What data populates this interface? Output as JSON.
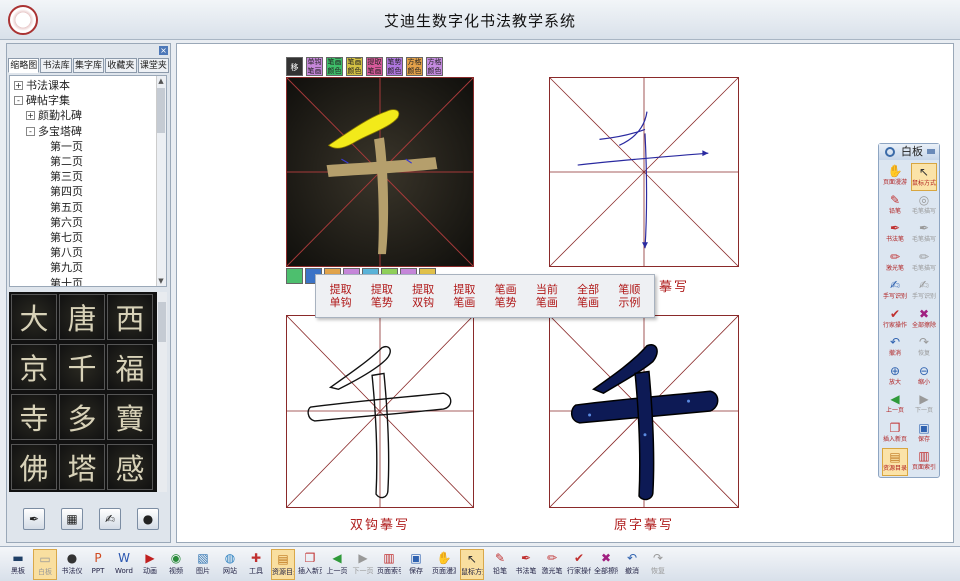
{
  "app": {
    "title": "艾迪生数字化书法教学系统"
  },
  "left_panel": {
    "close_glyph": "×",
    "tabs": [
      "缩略图",
      "书法库",
      "集字库",
      "收藏夹",
      "课堂夹"
    ],
    "tree": [
      {
        "label": "书法课本",
        "level": 0,
        "toggle": "+"
      },
      {
        "label": "碑帖字集",
        "level": 0,
        "toggle": "-"
      },
      {
        "label": "颜勤礼碑",
        "level": 1,
        "toggle": "+"
      },
      {
        "label": "多宝塔碑",
        "level": 1,
        "toggle": "-"
      },
      {
        "label": "第一页",
        "level": 2
      },
      {
        "label": "第二页",
        "level": 2
      },
      {
        "label": "第三页",
        "level": 2
      },
      {
        "label": "第四页",
        "level": 2
      },
      {
        "label": "第五页",
        "level": 2
      },
      {
        "label": "第六页",
        "level": 2
      },
      {
        "label": "第七页",
        "level": 2
      },
      {
        "label": "第八页",
        "level": 2
      },
      {
        "label": "第九页",
        "level": 2
      },
      {
        "label": "第十页",
        "level": 2
      }
    ],
    "thumbnails": [
      "大",
      "唐",
      "西",
      "京",
      "千",
      "福",
      "寺",
      "多",
      "寶",
      "佛",
      "塔",
      "感"
    ],
    "bottom_buttons": [
      {
        "name": "brush-tool-button",
        "glyph": "✒"
      },
      {
        "name": "grid-tool-button",
        "glyph": "▦"
      },
      {
        "name": "ink-tool-button",
        "glyph": "✍"
      },
      {
        "name": "color-tool-button",
        "glyph": "●"
      }
    ]
  },
  "canvas": {
    "grids": [
      {
        "name": "practice-grid-original",
        "caption": ""
      },
      {
        "name": "practice-grid-stroke-order",
        "caption": "摹写"
      },
      {
        "name": "practice-grid-outline",
        "caption": "双钩摹写"
      },
      {
        "name": "practice-grid-filled",
        "caption": "原字摹写"
      }
    ],
    "move_label": "移动",
    "color_buttons": [
      {
        "label": "单钩笔画",
        "color": "#c586d9"
      },
      {
        "label": "笔画颜色",
        "color": "#3fbf6a"
      },
      {
        "label": "笔画颜色",
        "color": "#d4c244"
      },
      {
        "label": "提取笔画",
        "color": "#d65a9a"
      },
      {
        "label": "笔势颜色",
        "color": "#b077e0"
      },
      {
        "label": "方格颜色",
        "color": "#e4a24a"
      },
      {
        "label": "方格颜色",
        "color": "#c58be0"
      }
    ],
    "small_buttons": [
      "#4dbf6e",
      "#3b73c6",
      "#e1a34a",
      "#c586d9",
      "#5ab3d8",
      "#8fcf5a",
      "#c586d9",
      "#e0c04a"
    ],
    "character": "千",
    "popup_menu": [
      {
        "line1": "提取",
        "line2": "单钩"
      },
      {
        "line1": "提取",
        "line2": "笔势"
      },
      {
        "line1": "提取",
        "line2": "双钩"
      },
      {
        "line1": "提取",
        "line2": "笔画"
      },
      {
        "line1": "笔画",
        "line2": "笔势"
      },
      {
        "line1": "当前",
        "line2": "笔画"
      },
      {
        "line1": "全部",
        "line2": "笔画"
      },
      {
        "line1": "笔顺",
        "line2": "示例"
      }
    ]
  },
  "whiteboard": {
    "title": "白板",
    "tools": [
      {
        "label": "页面漫游",
        "glyph": "✋",
        "color": "#c07a20",
        "sel": false
      },
      {
        "label": "鼠标方式",
        "glyph": "↖",
        "color": "#333",
        "sel": true
      },
      {
        "label": "铅笔",
        "glyph": "✎",
        "color": "#c03030",
        "sel": false
      },
      {
        "label": "毛笔描写",
        "glyph": "◎",
        "color": "#999",
        "sel": false
      },
      {
        "label": "书法笔",
        "glyph": "✒",
        "color": "#c03030",
        "sel": false
      },
      {
        "label": "毛笔描写",
        "glyph": "✒",
        "color": "#999",
        "sel": false
      },
      {
        "label": "激光笔",
        "glyph": "✏",
        "color": "#c03030",
        "sel": false
      },
      {
        "label": "毛笔描写",
        "glyph": "✏",
        "color": "#999",
        "sel": false
      },
      {
        "label": "手写识别",
        "glyph": "✍",
        "color": "#2f62b0",
        "sel": false
      },
      {
        "label": "手写识别",
        "glyph": "✍",
        "color": "#999",
        "sel": false
      },
      {
        "label": "行家操作",
        "glyph": "✔",
        "color": "#c03030",
        "sel": false
      },
      {
        "label": "全部擦除",
        "glyph": "✖",
        "color": "#a02080",
        "sel": false
      },
      {
        "label": "撤消",
        "glyph": "↶",
        "color": "#2f62b0",
        "sel": false
      },
      {
        "label": "恢复",
        "glyph": "↷",
        "color": "#999",
        "sel": false
      },
      {
        "label": "放大",
        "glyph": "⊕",
        "color": "#2f62b0",
        "sel": false
      },
      {
        "label": "缩小",
        "glyph": "⊖",
        "color": "#2f62b0",
        "sel": false
      },
      {
        "label": "上一页",
        "glyph": "◀",
        "color": "#2f9a3a",
        "sel": false
      },
      {
        "label": "下一页",
        "glyph": "▶",
        "color": "#999",
        "sel": false
      },
      {
        "label": "插入新页",
        "glyph": "❐",
        "color": "#c03030",
        "sel": false
      },
      {
        "label": "保存",
        "glyph": "▣",
        "color": "#2f62b0",
        "sel": false
      },
      {
        "label": "资源目录",
        "glyph": "▤",
        "color": "#c07a20",
        "sel": true
      },
      {
        "label": "页面索引",
        "glyph": "▥",
        "color": "#c03030",
        "sel": false
      }
    ]
  },
  "bottom_toolbar": {
    "buttons": [
      {
        "label": "黑板",
        "glyph": "▬",
        "color": "#1f3f66",
        "sel": false
      },
      {
        "label": "白板",
        "glyph": "▭",
        "color": "#999",
        "sel": true
      },
      {
        "label": "书法仪",
        "glyph": "●",
        "color": "#333",
        "sel": false
      },
      {
        "label": "PPT",
        "glyph": "P",
        "color": "#d04a20",
        "sel": false
      },
      {
        "label": "Word",
        "glyph": "W",
        "color": "#2a56b0",
        "sel": false
      },
      {
        "label": "动画",
        "glyph": "▶",
        "color": "#c02020",
        "sel": false
      },
      {
        "label": "视频",
        "glyph": "◉",
        "color": "#2a8a3a",
        "sel": false
      },
      {
        "label": "图片",
        "glyph": "▧",
        "color": "#2a70b0",
        "sel": false
      },
      {
        "label": "网站",
        "glyph": "◍",
        "color": "#2a80c0",
        "sel": false
      },
      {
        "label": "工具",
        "glyph": "✚",
        "color": "#c03030",
        "sel": false
      },
      {
        "label": "资源目录",
        "glyph": "▤",
        "color": "#c07a20",
        "sel": true
      },
      {
        "label": "插入新页",
        "glyph": "❐",
        "color": "#c03030",
        "sel": false
      },
      {
        "label": "上一页",
        "glyph": "◀",
        "color": "#2f9a3a",
        "sel": false
      },
      {
        "label": "下一页",
        "glyph": "▶",
        "color": "#999",
        "sel": false
      },
      {
        "label": "页面索引",
        "glyph": "▥",
        "color": "#c03030",
        "sel": false
      },
      {
        "label": "保存",
        "glyph": "▣",
        "color": "#2f62b0",
        "sel": false
      },
      {
        "label": "页面漫游",
        "glyph": "✋",
        "color": "#c07a20",
        "sel": false
      },
      {
        "label": "鼠标方式",
        "glyph": "↖",
        "color": "#333",
        "sel": true
      },
      {
        "label": "铅笔",
        "glyph": "✎",
        "color": "#c03030",
        "sel": false
      },
      {
        "label": "书法笔",
        "glyph": "✒",
        "color": "#c03030",
        "sel": false
      },
      {
        "label": "激光笔",
        "glyph": "✏",
        "color": "#c03030",
        "sel": false
      },
      {
        "label": "行家操作",
        "glyph": "✔",
        "color": "#c03030",
        "sel": false
      },
      {
        "label": "全部擦除",
        "glyph": "✖",
        "color": "#a02080",
        "sel": false
      },
      {
        "label": "撤消",
        "glyph": "↶",
        "color": "#2f62b0",
        "sel": false
      },
      {
        "label": "恢复",
        "glyph": "↷",
        "color": "#999",
        "sel": false
      }
    ]
  }
}
